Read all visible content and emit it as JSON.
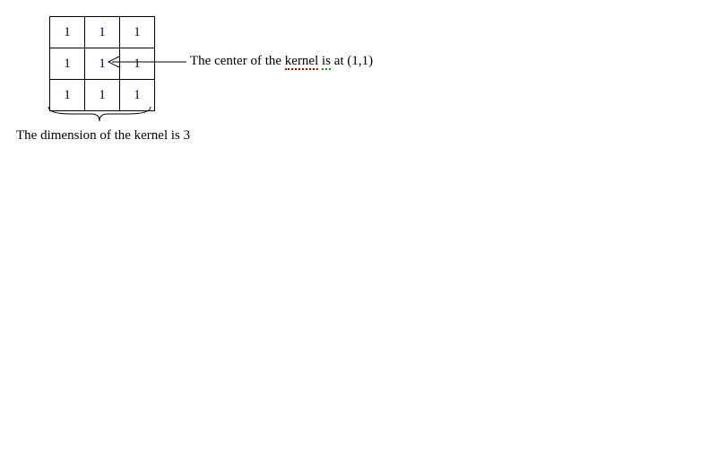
{
  "kernel": {
    "cells": [
      [
        "1",
        "1",
        "1"
      ],
      [
        "1",
        "1",
        "1"
      ],
      [
        "1",
        "1",
        "1"
      ]
    ]
  },
  "labels": {
    "center_prefix": "The center of the ",
    "center_word1": "kernel",
    "center_mid": "  ",
    "center_word2": "is",
    "center_suffix": " at (1,1)",
    "dimension": "The dimension of the kernel is 3"
  }
}
